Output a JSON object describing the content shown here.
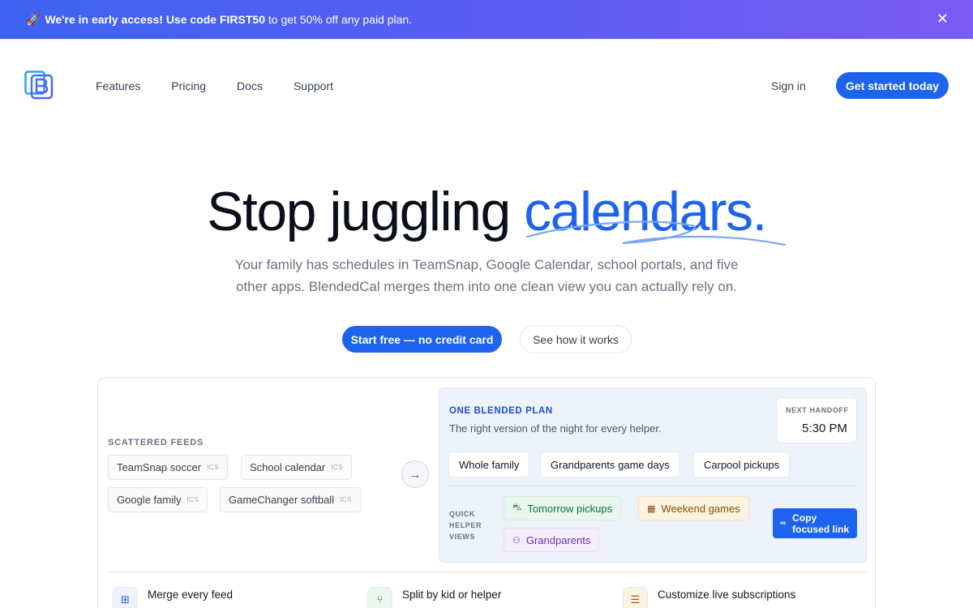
{
  "announcement": {
    "rocket": "🚀",
    "text_before": "We're in early access! Use code ",
    "code": "FIRST50",
    "text_after": " to get 50% off any paid plan.",
    "close": "✕"
  },
  "nav": {
    "links": [
      "Features",
      "Pricing",
      "Docs",
      "Support"
    ],
    "sign_in": "Sign in",
    "cta": "Get started today"
  },
  "hero": {
    "title_plain": "Stop juggling ",
    "title_accent": "calendars.",
    "subtitle": "Your family has schedules in TeamSnap, Google Calendar, school portals, and five other apps. BlendedCal merges them into one clean view you can actually rely on.",
    "primary_button": "Start free — no credit card",
    "secondary_button": "See how it works"
  },
  "demo": {
    "scattered_label": "SCATTERED FEEDS",
    "feeds": [
      {
        "name": "TeamSnap soccer",
        "tag": "ICS"
      },
      {
        "name": "School calendar",
        "tag": "ICS"
      },
      {
        "name": "Google family",
        "tag": "ICS"
      },
      {
        "name": "GameChanger softball",
        "tag": "ICS"
      }
    ],
    "arrow": "→",
    "plan": {
      "title": "ONE BLENDED PLAN",
      "subtitle": "The right version of the night for every helper.",
      "handoff_label": "NEXT HANDOFF",
      "handoff_time": "5:30 PM",
      "views": [
        "Whole family",
        "Grandparents game days",
        "Carpool pickups"
      ],
      "quick_label_lines": [
        "QUICK",
        "HELPER",
        "VIEWS"
      ],
      "quick_views": [
        {
          "label": "Tomorrow pickups",
          "icon": "car-icon"
        },
        {
          "label": "Weekend games",
          "icon": "calendar-icon"
        },
        {
          "label": "Grandparents",
          "icon": "people-icon"
        }
      ],
      "copy_button_lines": [
        "Copy",
        "focused link"
      ]
    },
    "features": [
      {
        "label": "Merge every feed",
        "icon": "merge-icon"
      },
      {
        "label": "Split by kid or helper",
        "icon": "split-icon"
      },
      {
        "label": "Customize live subscriptions",
        "icon": "sliders-icon"
      }
    ]
  },
  "colors": {
    "accent": "#1d63ed",
    "banner_start": "#3d63f0",
    "banner_end": "#7b5cf4"
  }
}
